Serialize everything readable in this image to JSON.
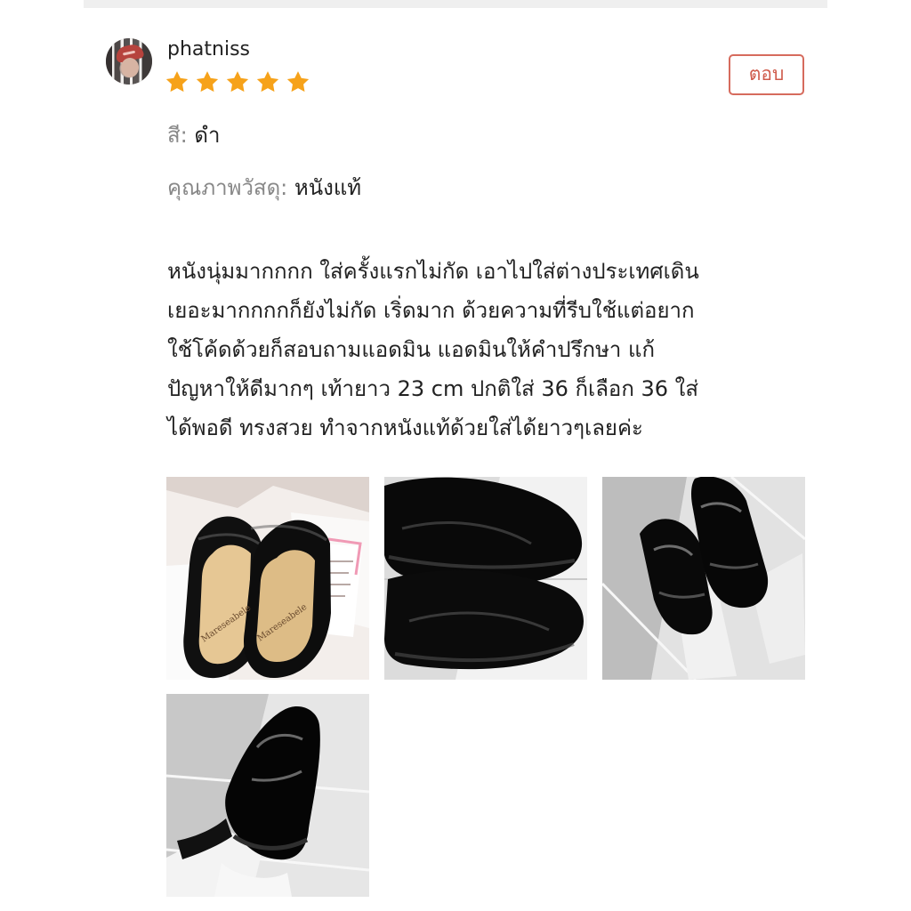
{
  "review": {
    "username": "phatniss",
    "rating": 5,
    "reply_label": "ตอบ",
    "color": {
      "label": "สี: ",
      "value": "ดำ"
    },
    "material": {
      "label": "คุณภาพวัสดุ: ",
      "value": "หนังแท้"
    },
    "text_lines": [
      "หนังนุ่มมากกกก ใส่ครั้งแรกไม่กัด เอาไปใส่ต่างประเทศเดิน",
      "เยอะมากกกกก็ยังไม่กัด เริ่ดมาก ด้วยความที่รีบใช้แต่อยาก",
      "ใช้โค้ดด้วยก็สอบถามแอดมิน แอดมินให้คำปรึกษา แก้",
      "ปัญหาให้ดีมากๆ เท้ายาว 23 cm ปกติใส่ 36 ก็เลือก 36 ใส่",
      "ได้พอดี ทรงสวย ทำจากหนังแท้ด้วยใส่ได้ยาวๆเลยค่ะ"
    ],
    "photos": [
      {
        "icon": "shoe-box-photo"
      },
      {
        "icon": "shoe-closeup-photo"
      },
      {
        "icon": "worn-shoes-photo"
      },
      {
        "icon": "single-worn-shoe-photo"
      }
    ]
  },
  "colors": {
    "reply_accent": "#cf5b4b",
    "star": "#f6a21a",
    "muted_label": "#888888",
    "text": "#222222"
  }
}
